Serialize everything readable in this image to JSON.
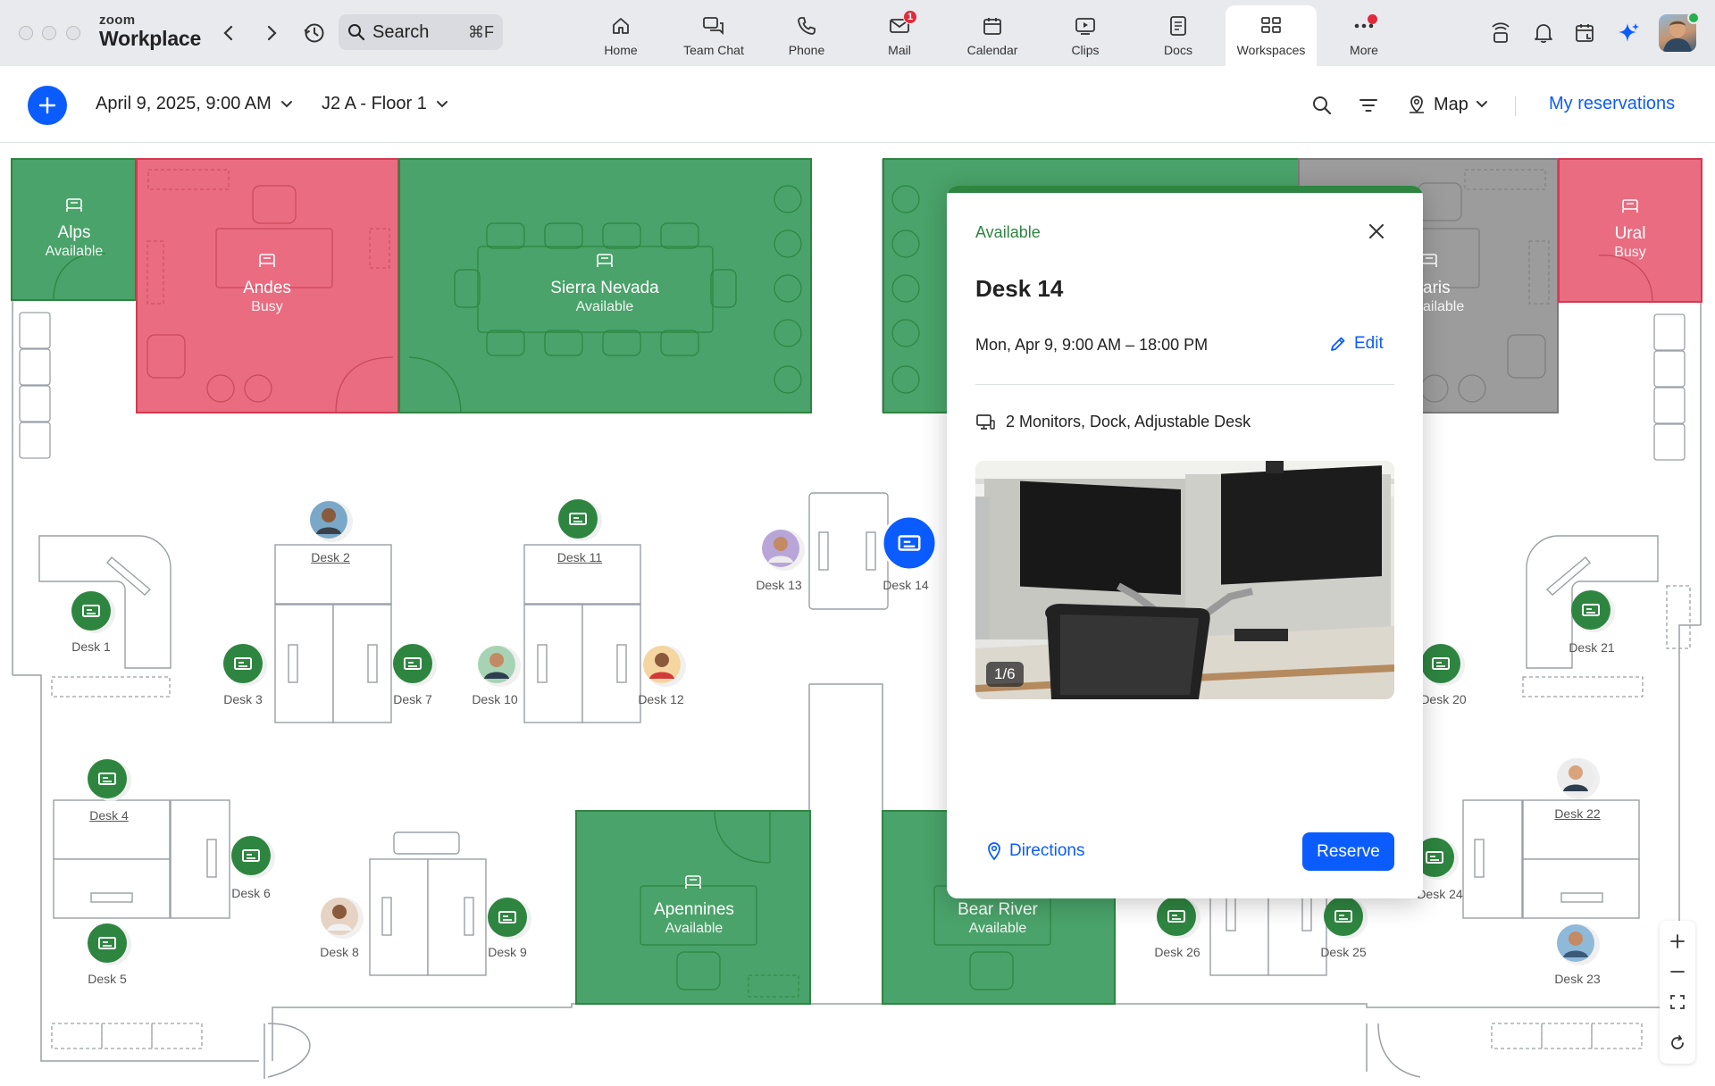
{
  "app": {
    "brand_top": "zoom",
    "brand_bottom": "Workplace"
  },
  "search": {
    "label": "Search",
    "shortcut": "⌘F"
  },
  "nav_tabs": [
    {
      "label": "Home"
    },
    {
      "label": "Team Chat"
    },
    {
      "label": "Phone"
    },
    {
      "label": "Mail",
      "badge": "1"
    },
    {
      "label": "Calendar"
    },
    {
      "label": "Clips"
    },
    {
      "label": "Docs"
    },
    {
      "label": "Workspaces"
    },
    {
      "label": "More"
    }
  ],
  "toolbar": {
    "date": "April 9, 2025, 9:00 AM",
    "location": "J2 A - Floor 1",
    "view": "Map",
    "my_reservations": "My reservations"
  },
  "rooms": [
    {
      "name": "Alps",
      "status": "Available"
    },
    {
      "name": "Andes",
      "status": "Busy"
    },
    {
      "name": "Sierra Nevada",
      "status": "Available"
    },
    {
      "name": "aris",
      "status": "ailable"
    },
    {
      "name": "Ural",
      "status": "Busy"
    },
    {
      "name": "Apennines",
      "status": "Available"
    },
    {
      "name": "Bear River",
      "status": "Available"
    }
  ],
  "desks": [
    "Desk 1",
    "Desk 2",
    "Desk 3",
    "Desk 4",
    "Desk 5",
    "Desk 6",
    "Desk 7",
    "Desk 8",
    "Desk 9",
    "Desk 10",
    "Desk 11",
    "Desk 12",
    "Desk 13",
    "Desk 14",
    "Desk 20",
    "Desk 21",
    "Desk 22",
    "Desk 23",
    "Desk 24",
    "Desk 25",
    "Desk 26"
  ],
  "popup": {
    "status": "Available",
    "title": "Desk 14",
    "time": "Mon, Apr 9, 9:00 AM – 18:00 PM",
    "edit_label": "Edit",
    "amenities": "2 Monitors, Dock, Adjustable Desk",
    "photo_counter": "1/6",
    "directions_label": "Directions",
    "reserve_label": "Reserve"
  },
  "colors": {
    "accent": "#0b5cff",
    "available": "#2e8540",
    "busy": "#e8516a",
    "unavailable": "#8e8e8e"
  }
}
